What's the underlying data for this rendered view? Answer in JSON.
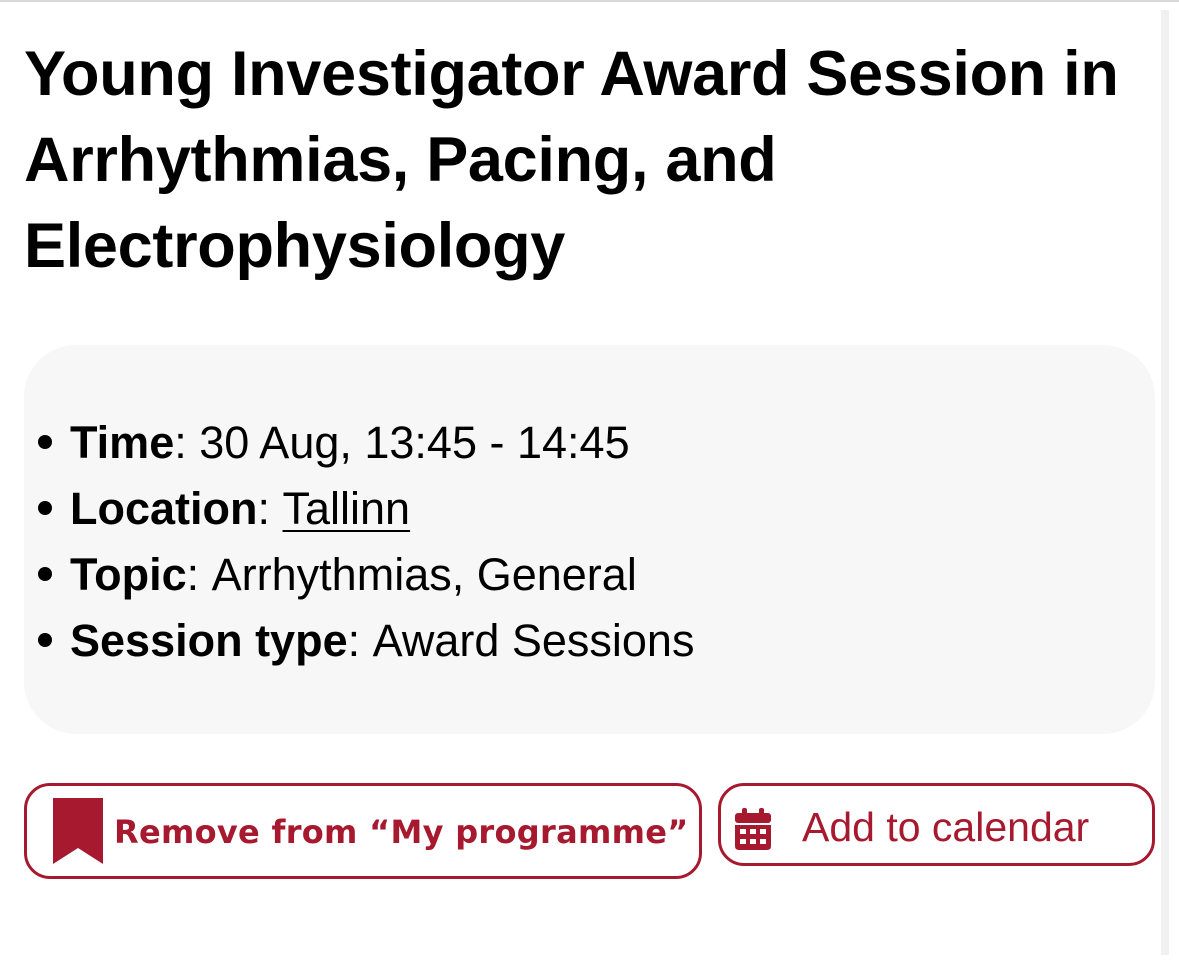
{
  "session": {
    "title": "Young Investigator Award Session in Arrhythmias, Pacing, and Electrophysiology"
  },
  "details": {
    "time": {
      "label": "Time",
      "value": "30 Aug, 13:45 - 14:45"
    },
    "location": {
      "label": "Location",
      "value": "Tallinn"
    },
    "topic": {
      "label": "Topic",
      "value": "Arrhythmias, General"
    },
    "session_type": {
      "label": "Session type",
      "value": "Award Sessions"
    }
  },
  "separator": ": ",
  "actions": {
    "remove_label": "Remove from “My programme”",
    "remove_icon": "bookmark-icon",
    "calendar_label": "Add to calendar",
    "calendar_icon": "calendar-icon"
  },
  "colors": {
    "accent": "#a6192e",
    "info_box_bg": "#f7f7f7",
    "text": "#000000"
  }
}
